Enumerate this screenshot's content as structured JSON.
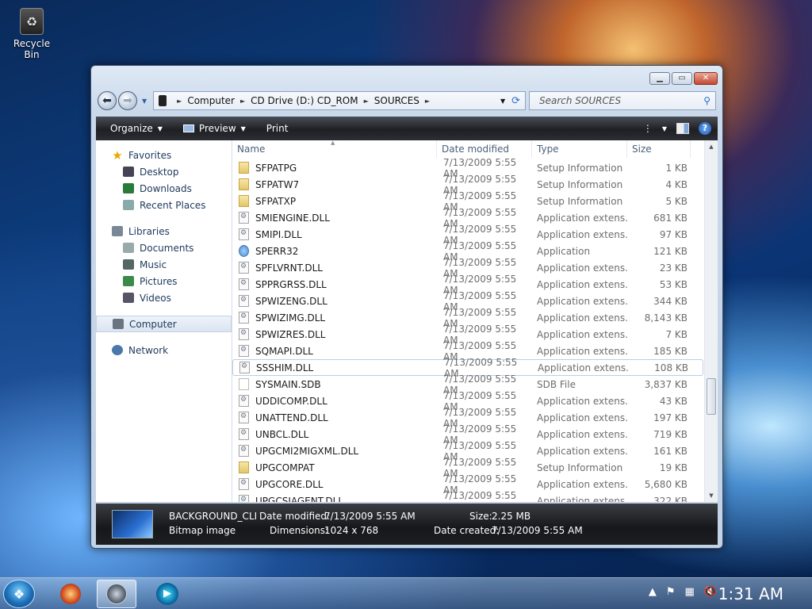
{
  "desktop": {
    "recycle_bin": "Recycle Bin"
  },
  "window": {
    "breadcrumb": [
      "Computer",
      "CD Drive (D:) CD_ROM",
      "SOURCES"
    ],
    "search_placeholder": "Search SOURCES",
    "toolbar": {
      "organize": "Organize",
      "preview": "Preview",
      "print": "Print"
    }
  },
  "nav": {
    "favorites": "Favorites",
    "desktop": "Desktop",
    "downloads": "Downloads",
    "recent": "Recent Places",
    "libraries": "Libraries",
    "documents": "Documents",
    "music": "Music",
    "pictures": "Pictures",
    "videos": "Videos",
    "computer": "Computer",
    "network": "Network"
  },
  "columns": {
    "name": "Name",
    "date": "Date modified",
    "type": "Type",
    "size": "Size"
  },
  "files": [
    {
      "name": "SFPATPG",
      "date": "7/13/2009 5:55 AM",
      "type": "Setup Information",
      "size": "1 KB",
      "kind": "setup"
    },
    {
      "name": "SFPATW7",
      "date": "7/13/2009 5:55 AM",
      "type": "Setup Information",
      "size": "4 KB",
      "kind": "setup"
    },
    {
      "name": "SFPATXP",
      "date": "7/13/2009 5:55 AM",
      "type": "Setup Information",
      "size": "5 KB",
      "kind": "setup"
    },
    {
      "name": "SMIENGINE.DLL",
      "date": "7/13/2009 5:55 AM",
      "type": "Application extens...",
      "size": "681 KB",
      "kind": "dll"
    },
    {
      "name": "SMIPI.DLL",
      "date": "7/13/2009 5:55 AM",
      "type": "Application extens...",
      "size": "97 KB",
      "kind": "dll"
    },
    {
      "name": "SPERR32",
      "date": "7/13/2009 5:55 AM",
      "type": "Application",
      "size": "121 KB",
      "kind": "app"
    },
    {
      "name": "SPFLVRNT.DLL",
      "date": "7/13/2009 5:55 AM",
      "type": "Application extens...",
      "size": "23 KB",
      "kind": "dll"
    },
    {
      "name": "SPPRGRSS.DLL",
      "date": "7/13/2009 5:55 AM",
      "type": "Application extens...",
      "size": "53 KB",
      "kind": "dll"
    },
    {
      "name": "SPWIZENG.DLL",
      "date": "7/13/2009 5:55 AM",
      "type": "Application extens...",
      "size": "344 KB",
      "kind": "dll"
    },
    {
      "name": "SPWIZIMG.DLL",
      "date": "7/13/2009 5:55 AM",
      "type": "Application extens...",
      "size": "8,143 KB",
      "kind": "dll"
    },
    {
      "name": "SPWIZRES.DLL",
      "date": "7/13/2009 5:55 AM",
      "type": "Application extens...",
      "size": "7 KB",
      "kind": "dll"
    },
    {
      "name": "SQMAPI.DLL",
      "date": "7/13/2009 5:55 AM",
      "type": "Application extens...",
      "size": "185 KB",
      "kind": "dll"
    },
    {
      "name": "SSSHIM.DLL",
      "date": "7/13/2009 5:55 AM",
      "type": "Application extens...",
      "size": "108 KB",
      "kind": "dll",
      "hover": true
    },
    {
      "name": "SYSMAIN.SDB",
      "date": "7/13/2009 5:55 AM",
      "type": "SDB File",
      "size": "3,837 KB",
      "kind": "sdb"
    },
    {
      "name": "UDDICOMP.DLL",
      "date": "7/13/2009 5:55 AM",
      "type": "Application extens...",
      "size": "43 KB",
      "kind": "dll"
    },
    {
      "name": "UNATTEND.DLL",
      "date": "7/13/2009 5:55 AM",
      "type": "Application extens...",
      "size": "197 KB",
      "kind": "dll"
    },
    {
      "name": "UNBCL.DLL",
      "date": "7/13/2009 5:55 AM",
      "type": "Application extens...",
      "size": "719 KB",
      "kind": "dll"
    },
    {
      "name": "UPGCMI2MIGXML.DLL",
      "date": "7/13/2009 5:55 AM",
      "type": "Application extens...",
      "size": "161 KB",
      "kind": "dll"
    },
    {
      "name": "UPGCOMPAT",
      "date": "7/13/2009 5:55 AM",
      "type": "Setup Information",
      "size": "19 KB",
      "kind": "setup"
    },
    {
      "name": "UPGCORE.DLL",
      "date": "7/13/2009 5:55 AM",
      "type": "Application extens...",
      "size": "5,680 KB",
      "kind": "dll"
    },
    {
      "name": "UPGCSIAGENT.DLL",
      "date": "7/13/2009 5:55 AM",
      "type": "Application extens...",
      "size": "322 KB",
      "kind": "dll"
    }
  ],
  "details": {
    "filename": "BACKGROUND_CLI",
    "filetype": "Bitmap image",
    "date_modified_label": "Date modified:",
    "date_modified": "7/13/2009 5:55 AM",
    "dimensions_label": "Dimensions:",
    "dimensions": "1024 x 768",
    "size_label": "Size:",
    "size": "2.25 MB",
    "date_created_label": "Date created:",
    "date_created": "7/13/2009 5:55 AM"
  },
  "taskbar": {
    "clock": "1:31 AM"
  }
}
